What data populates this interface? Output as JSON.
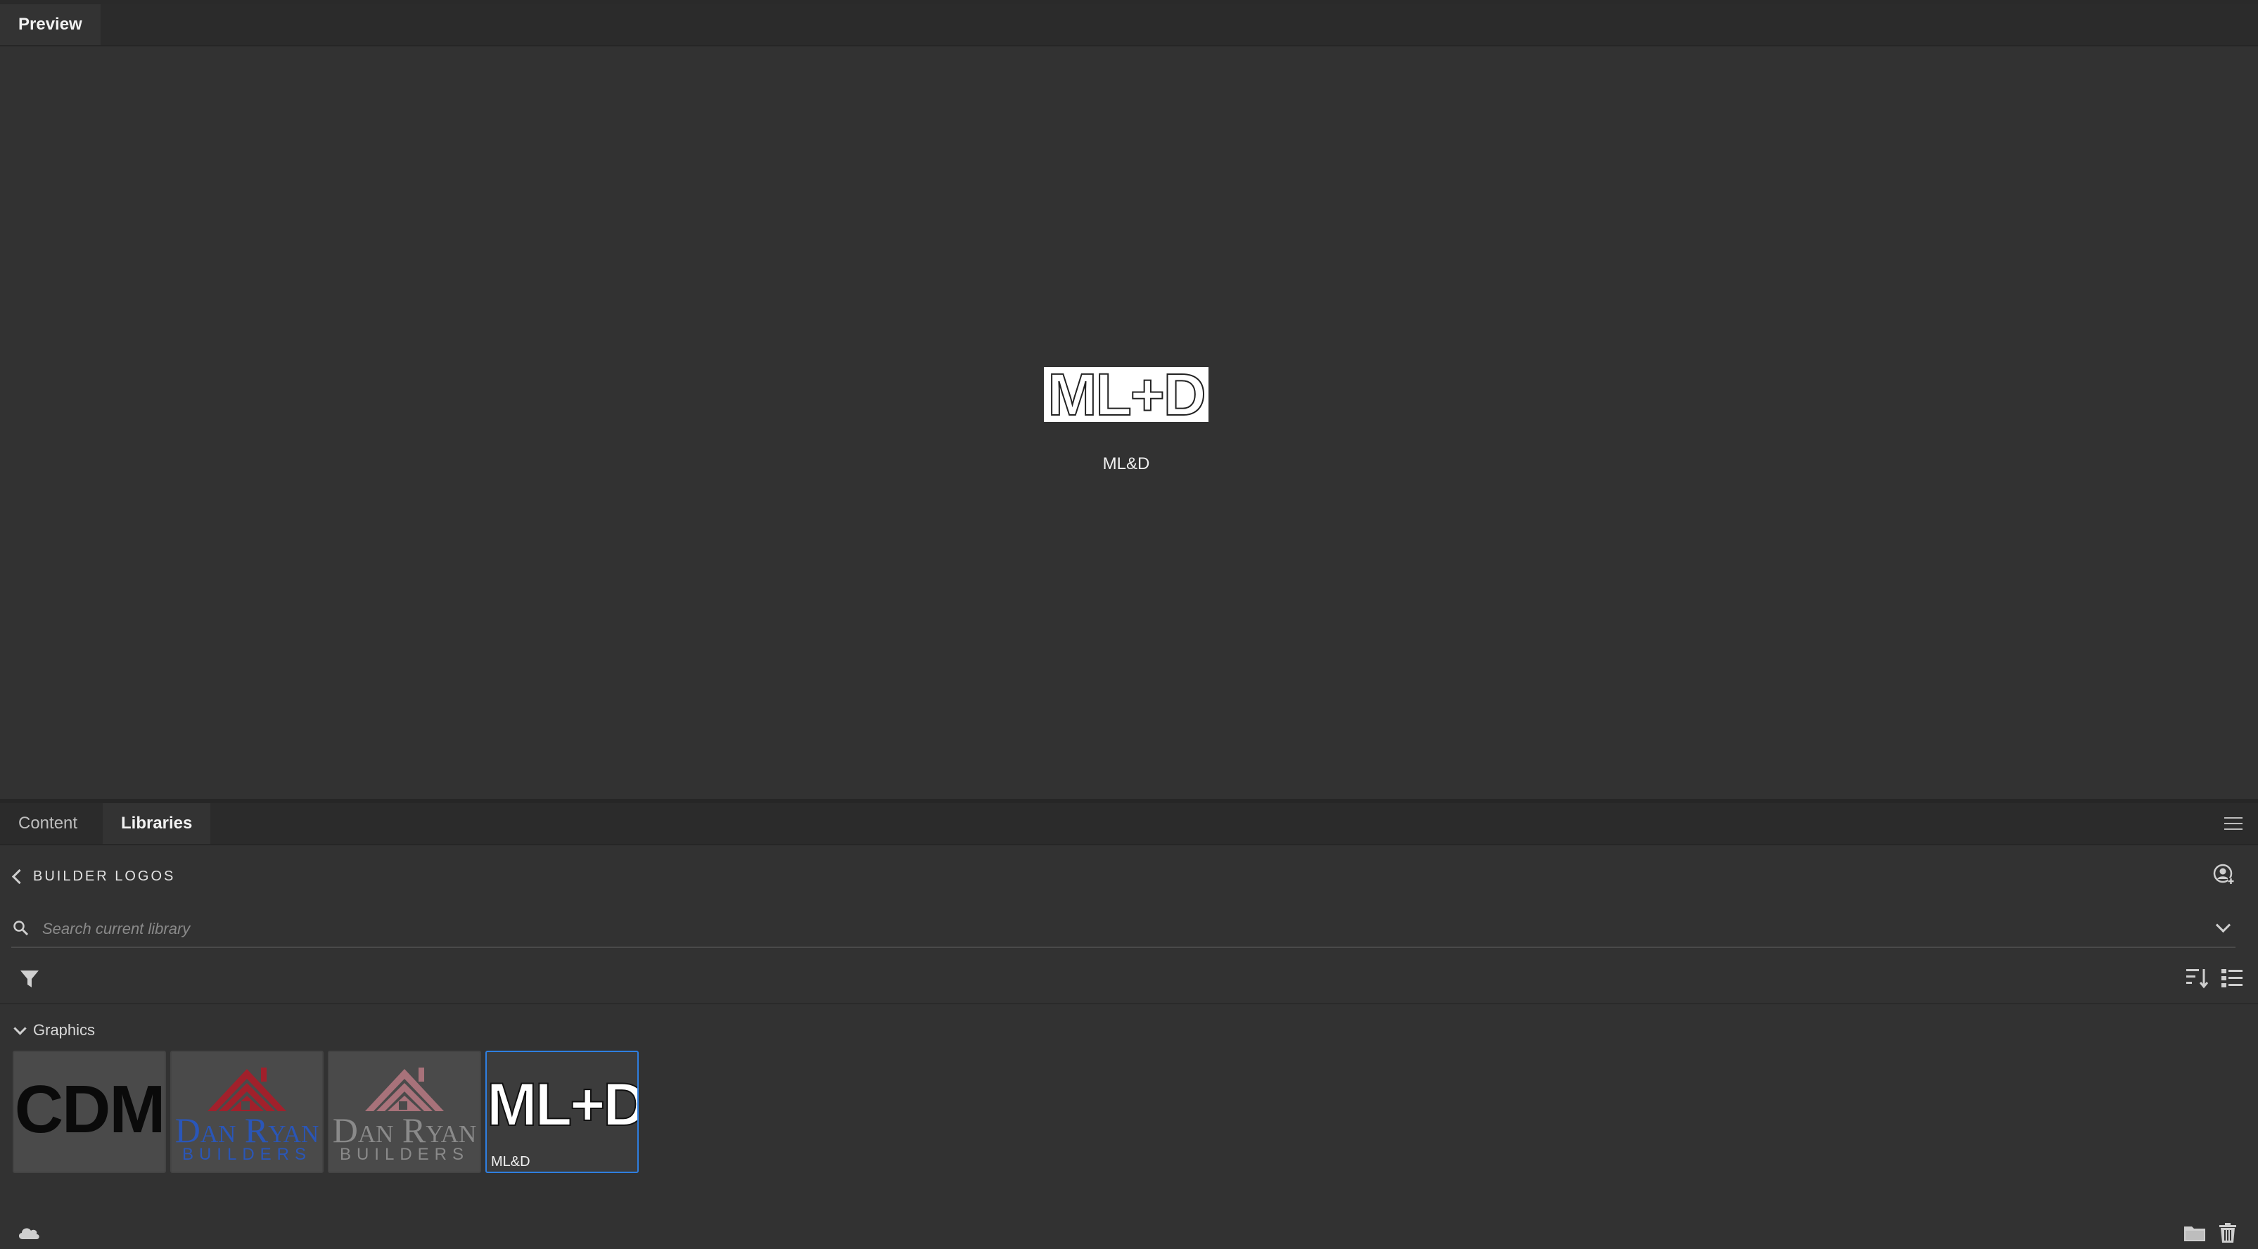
{
  "top_tabs": [
    {
      "label": "Preview"
    }
  ],
  "preview": {
    "logo_text": "ML+D",
    "asset_name": "ML&D"
  },
  "bottom_tabs": [
    {
      "label": "Content"
    },
    {
      "label": "Libraries"
    }
  ],
  "libraries": {
    "library_name": "BUILDER LOGOS",
    "search": {
      "placeholder": "Search current library",
      "value": ""
    },
    "section_label": "Graphics",
    "assets": [
      {
        "logo_text": "CDM",
        "label": ""
      },
      {
        "logo_text": "Dan Ryan",
        "logo_subtext": "BUILDERS",
        "label": "",
        "name_color": "#2a56b8",
        "sub_color": "#2a56b8",
        "roof_color": "#a1202b"
      },
      {
        "logo_text": "Dan Ryan",
        "logo_subtext": "BUILDERS",
        "label": "",
        "name_color": "#8a8a8a",
        "sub_color": "#8a8a8a",
        "roof_color": "#a8727a"
      },
      {
        "logo_text": "ML+D",
        "label": "ML&D",
        "selected": true
      }
    ]
  },
  "colors": {
    "selection": "#2f7fe0",
    "background": "#323232"
  }
}
